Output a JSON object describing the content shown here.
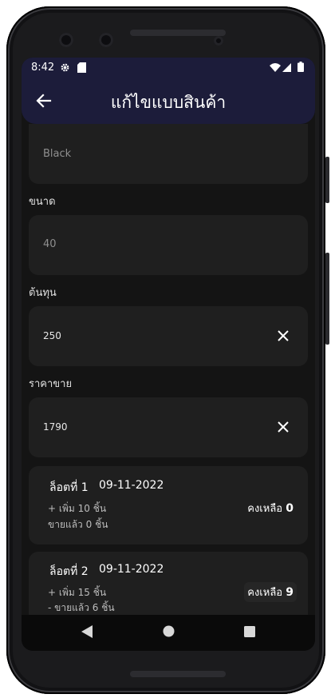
{
  "status": {
    "time": "8:42",
    "icons": [
      "gear-icon",
      "sd-card-icon",
      "wifi-icon",
      "signal-icon",
      "battery-icon"
    ]
  },
  "appbar": {
    "title": "แก้ไขแบบสินค้า",
    "back_icon": "back-arrow-icon"
  },
  "form": {
    "color_value": "Black",
    "size_label": "ขนาด",
    "size_value": "40",
    "cost_label": "ต้นทุน",
    "cost_value": "250",
    "price_label": "ราคาขาย",
    "price_value": "1790"
  },
  "lots": [
    {
      "title": "ล็อตที่ 1",
      "date": "09-11-2022",
      "added": "+ เพิ่ม 10 ชิ้น",
      "sold": "ขายแล้ว 0 ชิ้น",
      "remain_label": "คงเหลือ",
      "remain_value": "0"
    },
    {
      "title": "ล็อตที่ 2",
      "date": "09-11-2022",
      "added": "+ เพิ่ม 15 ชิ้น",
      "sold": "- ขายแล้ว 6 ชิ้น",
      "remain_label": "คงเหลือ",
      "remain_value": "9"
    }
  ],
  "nav": [
    "back-triangle-icon",
    "home-circle-icon",
    "recents-square-icon"
  ],
  "colors": {
    "appbar": "#1c1c3a",
    "background": "#141414",
    "card": "#1f1f1f"
  }
}
